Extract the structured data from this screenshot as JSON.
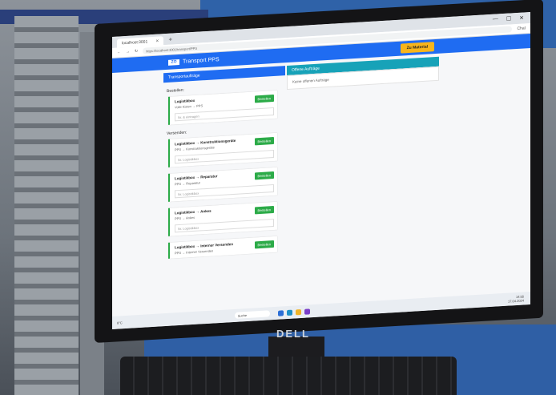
{
  "browser": {
    "tab_title": "localhost:3001",
    "tab_close": "✕",
    "new_tab": "+",
    "url": "https://localhost:3001/transport/PPS",
    "window_controls": [
      "—",
      "☐",
      "✕"
    ],
    "chat_label": "Chat"
  },
  "app": {
    "brand_logo": "ZO",
    "brand_name": "Transport PPS",
    "header_button": "Zu Material",
    "accent_color": "#1f6cf2",
    "button_color": "#f7b51a"
  },
  "left": {
    "panel_title": "Transportaufträge",
    "bestellen_title": "Bestellen:",
    "bestellen_cards": [
      {
        "title": "Logistikbox",
        "sub": "Volle Kisten → PPS",
        "button": "Bestellen",
        "input_placeholder": "Nr. & eintragen"
      }
    ],
    "versenden_title": "Versenden:",
    "versenden_cards": [
      {
        "title": "Logistikbox → Konstruktionsgeräte",
        "sub": "PPS → Konstruktionsgeräte",
        "button": "Bestellen",
        "input_placeholder": "Nr. Logistikbox"
      },
      {
        "title": "Logistikbox → Reparatur",
        "sub": "PPS → Reparatur",
        "button": "Bestellen",
        "input_placeholder": "Nr. Logistikbox"
      },
      {
        "title": "Logistikbox → Ankes",
        "sub": "PPS → Ankes",
        "button": "Bestellen",
        "input_placeholder": "Nr. Logistikbox"
      },
      {
        "title": "Logistikbox → Interner Versenden",
        "sub": "PPS → Interner Versenden",
        "button": "Bestellen",
        "input_placeholder": ""
      }
    ]
  },
  "right": {
    "panel_title": "Offene Aufträge",
    "empty_text": "Keine offenen Aufträge"
  },
  "taskbar": {
    "temp": "8°C",
    "search_placeholder": "Suche",
    "time": "14:55",
    "date": "17.04.2024"
  },
  "monitor_brand": "DELL"
}
